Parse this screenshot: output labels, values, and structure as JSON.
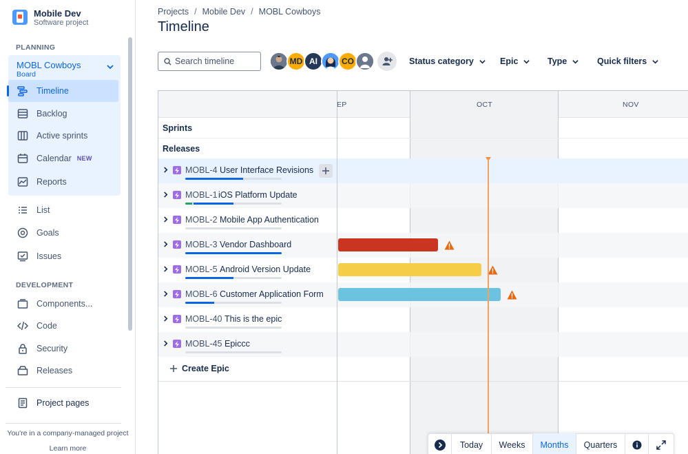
{
  "sidebar": {
    "project_name": "Mobile Dev",
    "project_type": "Software project",
    "planning_label": "PLANNING",
    "board_name": "MOBL Cowboys",
    "board_sub": "Board",
    "planning_items": [
      {
        "label": "Timeline"
      },
      {
        "label": "Backlog"
      },
      {
        "label": "Active sprints"
      },
      {
        "label": "Calendar",
        "badge": "NEW"
      },
      {
        "label": "Reports"
      }
    ],
    "other_items": [
      {
        "label": "List"
      },
      {
        "label": "Goals"
      },
      {
        "label": "Issues"
      }
    ],
    "development_label": "DEVELOPMENT",
    "dev_items": [
      {
        "label": "Components..."
      },
      {
        "label": "Code"
      },
      {
        "label": "Security"
      },
      {
        "label": "Releases"
      }
    ],
    "project_pages": "Project pages",
    "footer_note": "You're in a company-managed project",
    "learn_more": "Learn more"
  },
  "header": {
    "breadcrumb": [
      "Projects",
      "Mobile Dev",
      "MOBL Cowboys"
    ],
    "title": "Timeline"
  },
  "toolbar": {
    "search_placeholder": "Search timeline",
    "avatars": [
      {
        "initials": "",
        "color": "#5E6C84"
      },
      {
        "initials": "MD",
        "color": "#FFAB00"
      },
      {
        "initials": "AI",
        "color": "#253858"
      },
      {
        "initials": "",
        "color": "#4C9AFF"
      },
      {
        "initials": "CO",
        "color": "#FFAB00"
      },
      {
        "initials": "",
        "color": "#6B778C"
      }
    ],
    "filters": [
      "Status category",
      "Epic",
      "Type",
      "Quick filters"
    ]
  },
  "timeline": {
    "months": [
      "EP",
      "OCT",
      "NOV"
    ],
    "sprints_label": "Sprints",
    "releases_label": "Releases",
    "epics": [
      {
        "key": "MOBL-4",
        "title": "User Interface Revisions"
      },
      {
        "key": "MOBL-1",
        "title": "iOS Platform Update"
      },
      {
        "key": "MOBL-2",
        "title": "Mobile App Authentication"
      },
      {
        "key": "MOBL-3",
        "title": "Vendor Dashboard"
      },
      {
        "key": "MOBL-5",
        "title": "Android Version Update"
      },
      {
        "key": "MOBL-6",
        "title": "Customer Application Form"
      },
      {
        "key": "MOBL-40",
        "title": "This is the epic"
      },
      {
        "key": "MOBL-45",
        "title": "Epiccc"
      }
    ],
    "create_epic": "Create Epic"
  },
  "controls": {
    "today": "Today",
    "weeks": "Weeks",
    "months": "Months",
    "quarters": "Quarters"
  }
}
